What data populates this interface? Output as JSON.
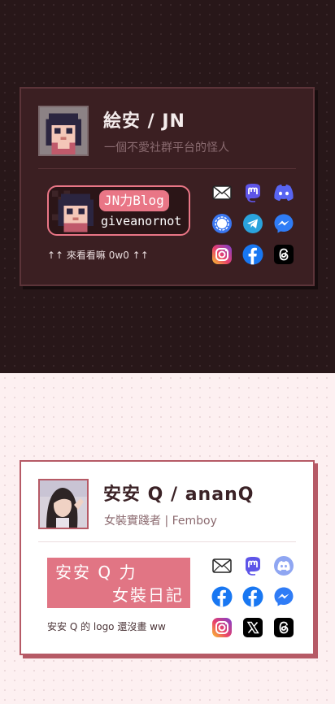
{
  "dark_card": {
    "name": "絵安 / JN",
    "tagline": "一個不愛社群平台的怪人",
    "blog_title": "JN力Blog",
    "blog_url": "giveanornot",
    "hint": "↑↑ 來看看嘛 0w0 ↑↑",
    "icons": [
      "mail-icon",
      "mastodon-icon",
      "discord-icon",
      "signal-icon",
      "telegram-icon",
      "messenger-icon",
      "instagram-icon",
      "facebook-icon",
      "threads-icon"
    ]
  },
  "light_card": {
    "name": "安安 Q / ananQ",
    "tagline": "女裝實踐者 | Femboy",
    "logo_line1": "安安 Q 力",
    "logo_line2": "女裝日記",
    "hint": "安安 Q 的 logo 還沒畫 ww",
    "icons": [
      "mail-icon",
      "mastodon-icon",
      "discord-icon",
      "facebook-icon",
      "facebook-icon",
      "messenger-icon",
      "instagram-icon",
      "x-icon",
      "threads-icon"
    ]
  },
  "colors": {
    "dark_bg": "#281719",
    "light_bg": "#fdf0f1",
    "accent_pink": "#e97686",
    "mastodon": "#5e55e8",
    "discord": "#5865f2",
    "signal": "#3a76f0",
    "telegram": "#2aa3dd",
    "facebook": "#1877f2"
  }
}
